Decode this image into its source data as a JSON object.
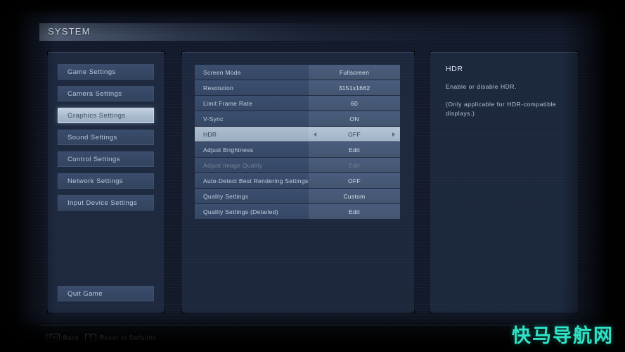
{
  "header": {
    "title": "SYSTEM"
  },
  "sidebar": {
    "items": [
      {
        "label": "Game Settings",
        "selected": false
      },
      {
        "label": "Camera Settings",
        "selected": false
      },
      {
        "label": "Graphics Settings",
        "selected": true
      },
      {
        "label": "Sound Settings",
        "selected": false
      },
      {
        "label": "Control Settings",
        "selected": false
      },
      {
        "label": "Network Settings",
        "selected": false
      },
      {
        "label": "Input Device Settings",
        "selected": false
      }
    ],
    "quit_label": "Quit Game"
  },
  "settings": {
    "rows": [
      {
        "label": "Screen Mode",
        "value": "Fullscreen",
        "selected": false,
        "disabled": false,
        "arrows": false
      },
      {
        "label": "Resolution",
        "value": "3151x1662",
        "selected": false,
        "disabled": false,
        "arrows": false
      },
      {
        "label": "Limit Frame Rate",
        "value": "60",
        "selected": false,
        "disabled": false,
        "arrows": false
      },
      {
        "label": "V-Sync",
        "value": "ON",
        "selected": false,
        "disabled": false,
        "arrows": false
      },
      {
        "label": "HDR",
        "value": "OFF",
        "selected": true,
        "disabled": false,
        "arrows": true
      },
      {
        "label": "Adjust Brightness",
        "value": "Edit",
        "selected": false,
        "disabled": false,
        "arrows": false
      },
      {
        "label": "Adjust Image Quality",
        "value": "Edit",
        "selected": false,
        "disabled": true,
        "arrows": false
      },
      {
        "label": "Auto-Detect Best Rendering Settings",
        "value": "OFF",
        "selected": false,
        "disabled": false,
        "arrows": false
      },
      {
        "label": "Quality Settings",
        "value": "Custom",
        "selected": false,
        "disabled": false,
        "arrows": false
      },
      {
        "label": "Quality Settings (Detailed)",
        "value": "Edit",
        "selected": false,
        "disabled": false,
        "arrows": false
      }
    ]
  },
  "info": {
    "title": "HDR",
    "line1": "Enable or disable HDR.",
    "line2": "(Only applicable for HDR-compatible displays.)"
  },
  "footer": {
    "hints": [
      {
        "key": "Esc",
        "label": ":Back"
      },
      {
        "key": "F",
        "label": ":Reset to Defaults"
      }
    ]
  },
  "watermark": {
    "text": "快马导航网"
  },
  "colors": {
    "accent_selected": "#b6c4d6",
    "panel_bg": "#283852",
    "text_primary": "#dce7f3",
    "watermark": "#2fe3c6"
  }
}
